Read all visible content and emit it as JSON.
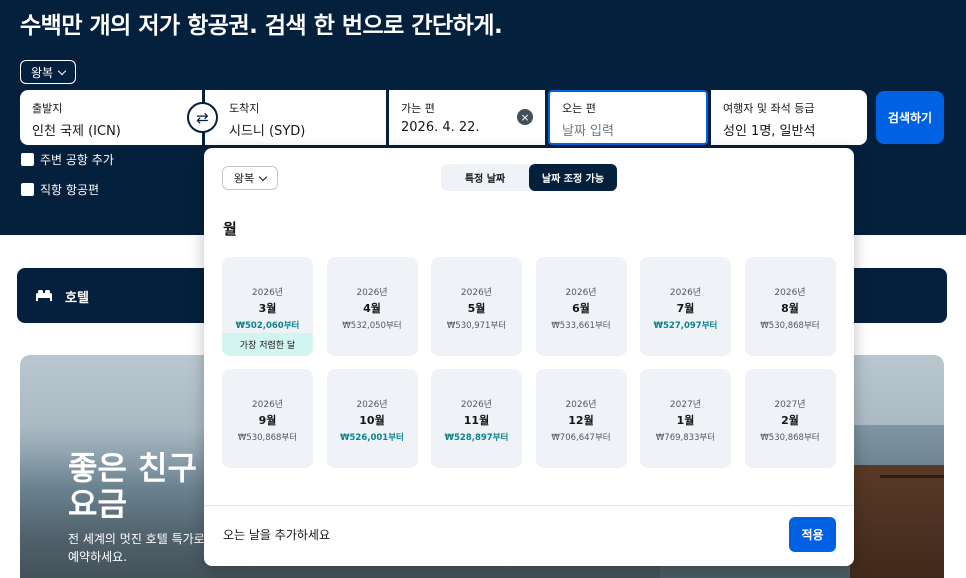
{
  "headline": "수백만 개의 저가 항공권. 검색 한 번으로 간단하게.",
  "trip_type": "왕복",
  "search": {
    "origin_label": "출발지",
    "origin_value": "인천 국제 (ICN)",
    "destination_label": "도착지",
    "destination_value": "시드니 (SYD)",
    "depart_label": "가는 편",
    "depart_value": "2026. 4. 22.",
    "return_label": "오는 편",
    "return_placeholder": "날짜 입력",
    "travellers_label": "여행자 및 좌석 등급",
    "travellers_value": "성인 1명, 일반석",
    "search_button": "검색하기",
    "swap_icon": "⇄",
    "clear_icon": "×"
  },
  "checkboxes": {
    "nearby_airports": "주변 공항 추가",
    "direct_flights": "직항 항공편"
  },
  "hotel_bar": {
    "label": "호텔"
  },
  "promo": {
    "title_line1": "좋은 친구",
    "title_line2": "요금",
    "subtitle_line1": "전 세계의 멋진 호텔 특가로",
    "subtitle_line2": "예약하세요."
  },
  "date_picker": {
    "trip_type": "왕복",
    "toggle_specific": "특정 날짜",
    "toggle_flexible": "날짜 조정 가능",
    "month_heading": "월",
    "cheapest_tag": "가장 저렴한 달",
    "months": [
      {
        "year": "2026년",
        "month": "3월",
        "price": "₩502,060부터",
        "cheap": true
      },
      {
        "year": "2026년",
        "month": "4월",
        "price": "₩532,050부터",
        "cheap": false
      },
      {
        "year": "2026년",
        "month": "5월",
        "price": "₩530,971부터",
        "cheap": false
      },
      {
        "year": "2026년",
        "month": "6월",
        "price": "₩533,661부터",
        "cheap": false
      },
      {
        "year": "2026년",
        "month": "7월",
        "price": "₩527,097부터",
        "cheap": true
      },
      {
        "year": "2026년",
        "month": "8월",
        "price": "₩530,868부터",
        "cheap": false
      },
      {
        "year": "2026년",
        "month": "9월",
        "price": "₩530,868부터",
        "cheap": false
      },
      {
        "year": "2026년",
        "month": "10월",
        "price": "₩526,001부터",
        "cheap": true
      },
      {
        "year": "2026년",
        "month": "11월",
        "price": "₩528,897부터",
        "cheap": true
      },
      {
        "year": "2026년",
        "month": "12월",
        "price": "₩706,647부터",
        "cheap": false
      },
      {
        "year": "2027년",
        "month": "1월",
        "price": "₩769,833부터",
        "cheap": false
      },
      {
        "year": "2027년",
        "month": "2월",
        "price": "₩530,868부터",
        "cheap": false
      }
    ],
    "footer_hint": "오는 날을 추가하세요",
    "apply_button": "적용"
  },
  "colors": {
    "navy": "#05203c",
    "primary_blue": "#0062e3",
    "cheap_teal": "#0c838a",
    "cheapest_tag_bg": "#d3f5ef",
    "card_bg": "#eff3f8"
  }
}
